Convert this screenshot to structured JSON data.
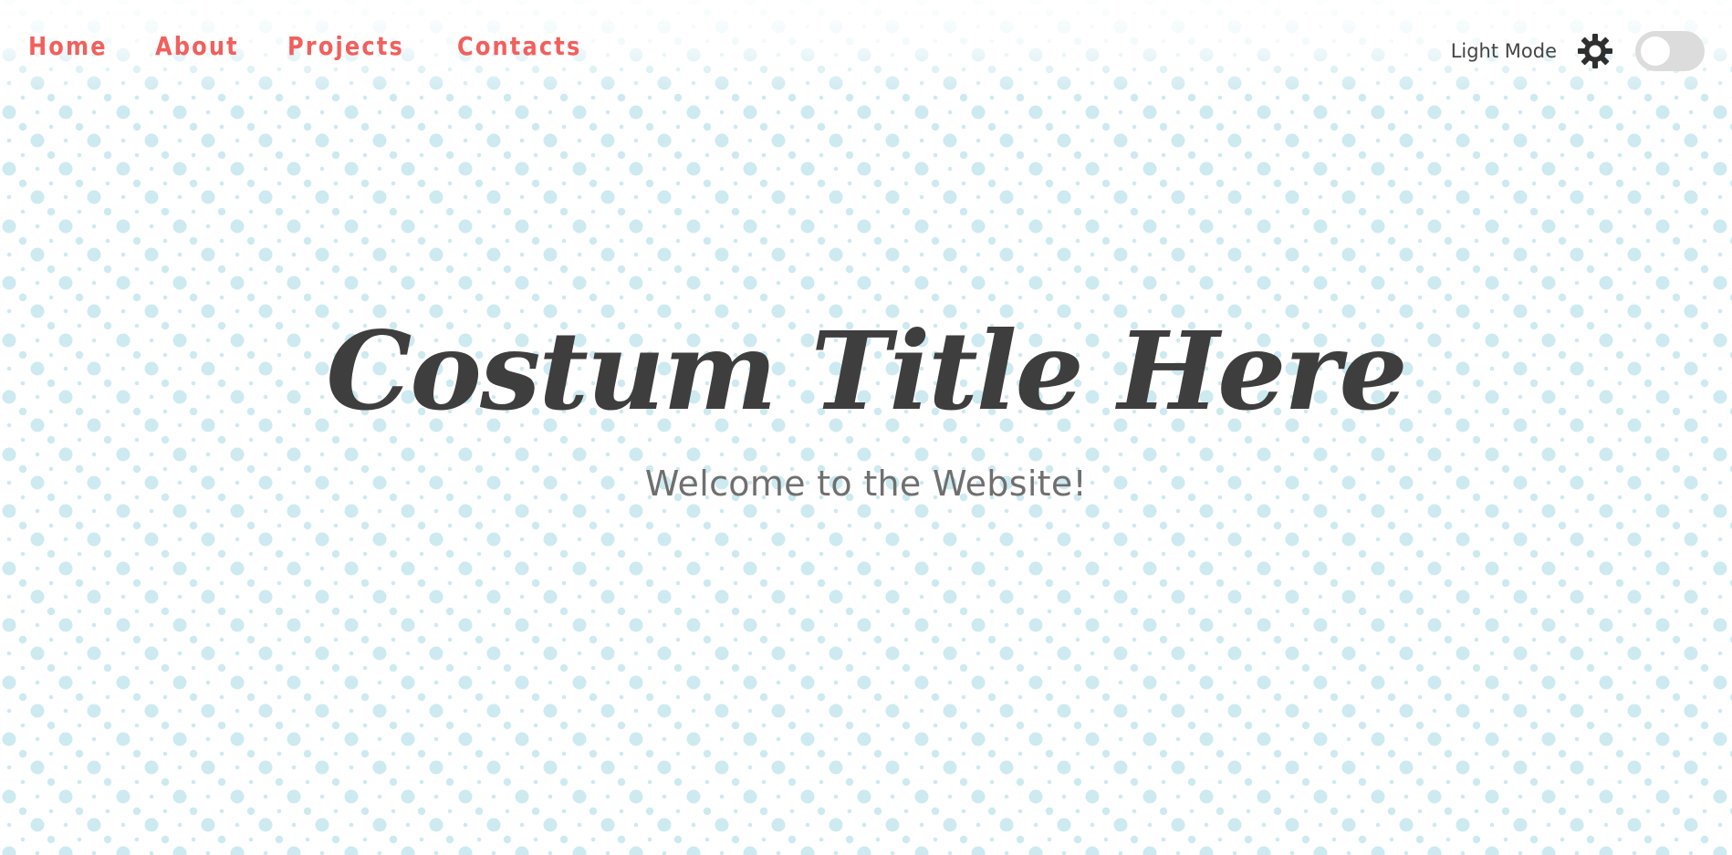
{
  "nav": {
    "items": [
      {
        "label": "Home"
      },
      {
        "label": "About"
      },
      {
        "label": "Projects"
      },
      {
        "label": "Contacts"
      }
    ]
  },
  "theme_toggle": {
    "label": "Light Mode",
    "icon": "sun-icon",
    "enabled": false
  },
  "hero": {
    "title": "Costum Title Here",
    "subtitle": "Welcome to the Website!"
  },
  "colors": {
    "accent": "#f25f5c",
    "title": "#3e3e3e",
    "subtitle": "#6f6f6f",
    "dots": "#cdeaf0",
    "toggle_track": "#dcdcdc"
  }
}
